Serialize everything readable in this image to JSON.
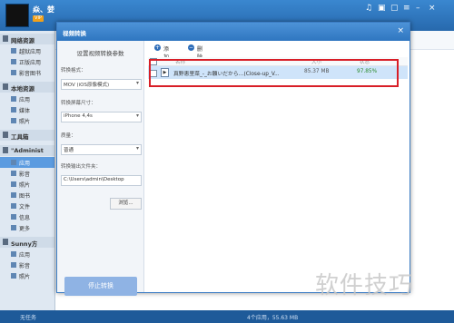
{
  "app": {
    "username": "焱、婪",
    "vip_badge": "VIP"
  },
  "window_icons": [
    "music-icon",
    "shirt-icon",
    "chat-icon",
    "menu-icon",
    "minimize-icon",
    "close-icon"
  ],
  "sidebar": {
    "sections": [
      {
        "label": "网络资源",
        "items": [
          "越狱应用",
          "正版应用",
          "影音图书"
        ]
      },
      {
        "label": "本地资源",
        "items": [
          "应用",
          "媒体",
          "照片"
        ]
      },
      {
        "label": "工具箱",
        "items": []
      },
      {
        "label": "\"Administ",
        "items": [
          "应用",
          "影音",
          "照片",
          "图书",
          "文件",
          "信息",
          "更多"
        ]
      },
      {
        "label": "Sunny方",
        "items": [
          "应用",
          "影音",
          "照片"
        ]
      }
    ],
    "selected": "应用"
  },
  "status_bar": {
    "left": "无任务",
    "right": "4个应用，55.63 MB"
  },
  "dialog": {
    "title": "视频转换",
    "panel_heading": "设置视频转换参数",
    "fields": [
      {
        "label": "转换格式：",
        "value": "MOV (iOS原像模式)"
      },
      {
        "label": "转换屏幕尺寸：",
        "value": "iPhone 4,4s"
      },
      {
        "label": "质量：",
        "value": "普通"
      }
    ],
    "output_label": "转换输出文件夹：",
    "output_path": "C:\\Users\\admin\\Desktop",
    "browse_label": "浏览...",
    "stop_label": "停止转换",
    "toolbar": {
      "add_label": "添加",
      "delete_label": "删除"
    },
    "columns": [
      "名称",
      "大小",
      "状态"
    ],
    "files": [
      {
        "name": "真野恵里菜_-_お願いだから…(Close-up_V...",
        "size": "85.37 MB",
        "status": "97.85%"
      }
    ]
  },
  "colors": {
    "title_bar": "#2f76c0",
    "selection": "#5b9be0",
    "status_green": "#2a8a2a",
    "highlight_box": "#d81e27"
  },
  "watermark": "软件技巧"
}
